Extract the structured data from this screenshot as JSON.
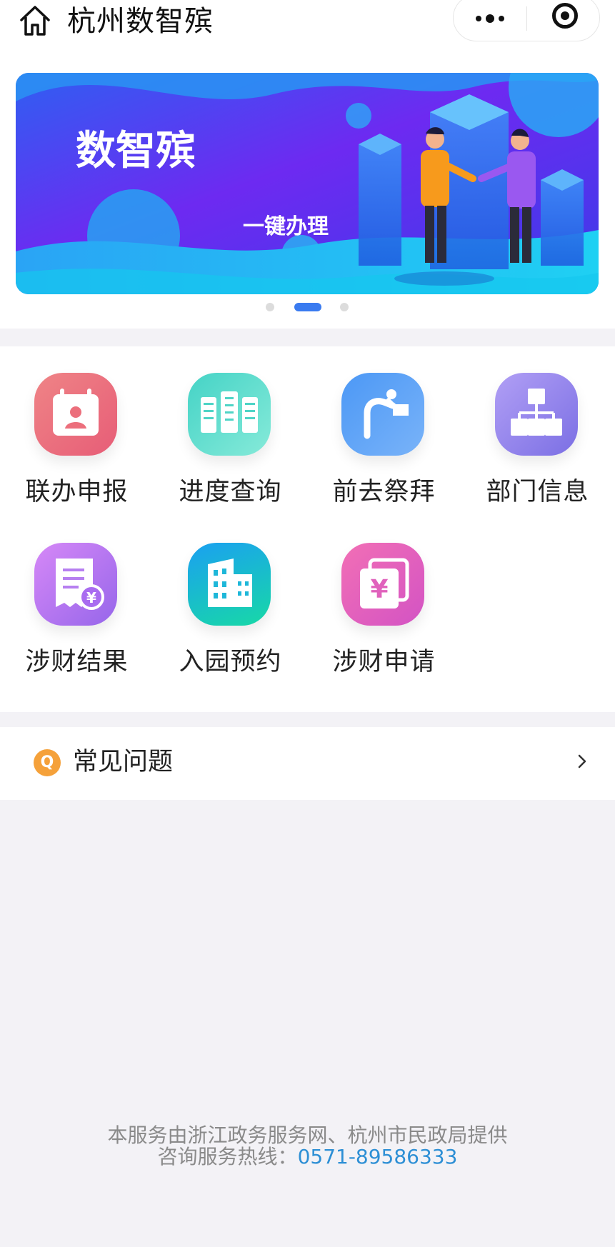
{
  "header": {
    "title": "杭州数智殡",
    "home_icon": "home-icon",
    "more_icon": "more-dots-icon",
    "close_icon": "target-icon"
  },
  "banner": {
    "headline": "数智殡",
    "subline": "一键办理",
    "slides_total": 3,
    "active_slide": 2
  },
  "services": [
    {
      "label": "联办申报",
      "icon": "calendar-person-icon",
      "color_from": "#ee7f82",
      "color_to": "#e75d77"
    },
    {
      "label": "进度查询",
      "icon": "server-icon",
      "color_from": "#49d6c9",
      "color_to": "#7ee8d8"
    },
    {
      "label": "前去祭拜",
      "icon": "bow-person-icon",
      "color_from": "#4e9cf5",
      "color_to": "#73aef8"
    },
    {
      "label": "部门信息",
      "icon": "org-chart-icon",
      "color_from": "#a99cf3",
      "color_to": "#7c6fe6"
    },
    {
      "label": "涉财结果",
      "icon": "receipt-yen-icon",
      "color_from": "#cf81f6",
      "color_to": "#9a69ec"
    },
    {
      "label": "入园预约",
      "icon": "building-icon",
      "color_from": "#1aa5f0",
      "color_to": "#18d5a8"
    },
    {
      "label": "涉财申请",
      "icon": "yen-doc-icon",
      "color_from": "#f06cb4",
      "color_to": "#d453c6"
    }
  ],
  "faq": {
    "label": "常见问题",
    "badge": "Q"
  },
  "footer": {
    "line1": "本服务由浙江政务服务网、杭州市民政局提供",
    "line2_prefix": "咨询服务热线：",
    "phone": "0571-89586333"
  }
}
